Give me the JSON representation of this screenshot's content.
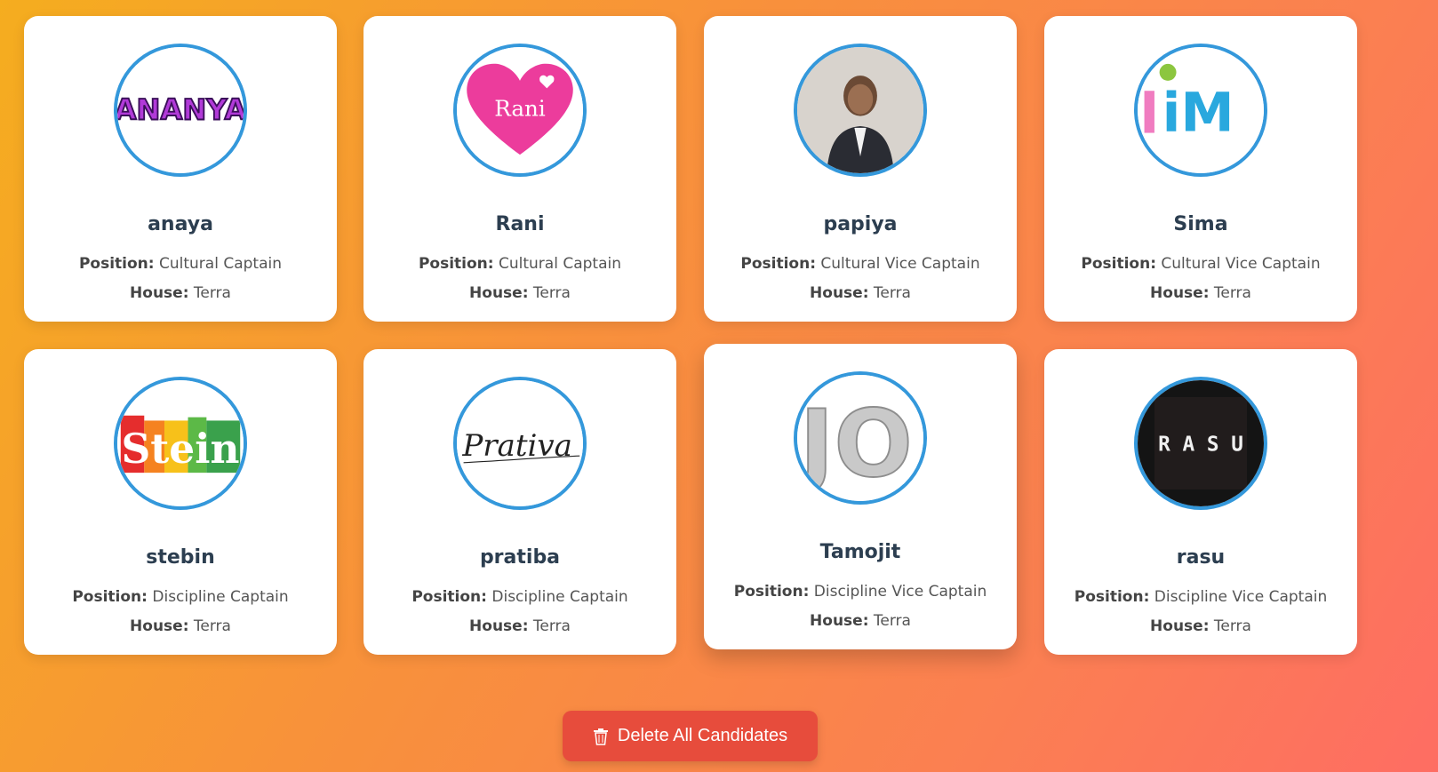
{
  "candidates": [
    {
      "name": "anaya",
      "position_label": "Position:",
      "position": "Cultural Captain",
      "house_label": "House:",
      "house": "Terra",
      "avatar_text": "ANANYA"
    },
    {
      "name": "Rani",
      "position_label": "Position:",
      "position": "Cultural Captain",
      "house_label": "House:",
      "house": "Terra",
      "avatar_text": "Rani"
    },
    {
      "name": "papiya",
      "position_label": "Position:",
      "position": "Cultural Vice Captain",
      "house_label": "House:",
      "house": "Terra"
    },
    {
      "name": "Sima",
      "position_label": "Position:",
      "position": "Cultural Vice Captain",
      "house_label": "House:",
      "house": "Terra",
      "avatar_text": "iM"
    },
    {
      "name": "stebin",
      "position_label": "Position:",
      "position": "Discipline Captain",
      "house_label": "House:",
      "house": "Terra",
      "avatar_text": "Stein"
    },
    {
      "name": "pratiba",
      "position_label": "Position:",
      "position": "Discipline Captain",
      "house_label": "House:",
      "house": "Terra",
      "avatar_text": "Prativa"
    },
    {
      "name": "Tamojit",
      "position_label": "Position:",
      "position": "Discipline Vice Captain",
      "house_label": "House:",
      "house": "Terra",
      "avatar_text": "JO"
    },
    {
      "name": "rasu",
      "position_label": "Position:",
      "position": "Discipline Vice Captain",
      "house_label": "House:",
      "house": "Terra",
      "avatar_text": "R A S U"
    }
  ],
  "actions": {
    "delete_all_label": "Delete All Candidates",
    "delete_all_icon": "trash-icon"
  },
  "colors": {
    "accent_border": "#3498db",
    "danger": "#e74c3c",
    "name_text": "#2c3e50"
  }
}
